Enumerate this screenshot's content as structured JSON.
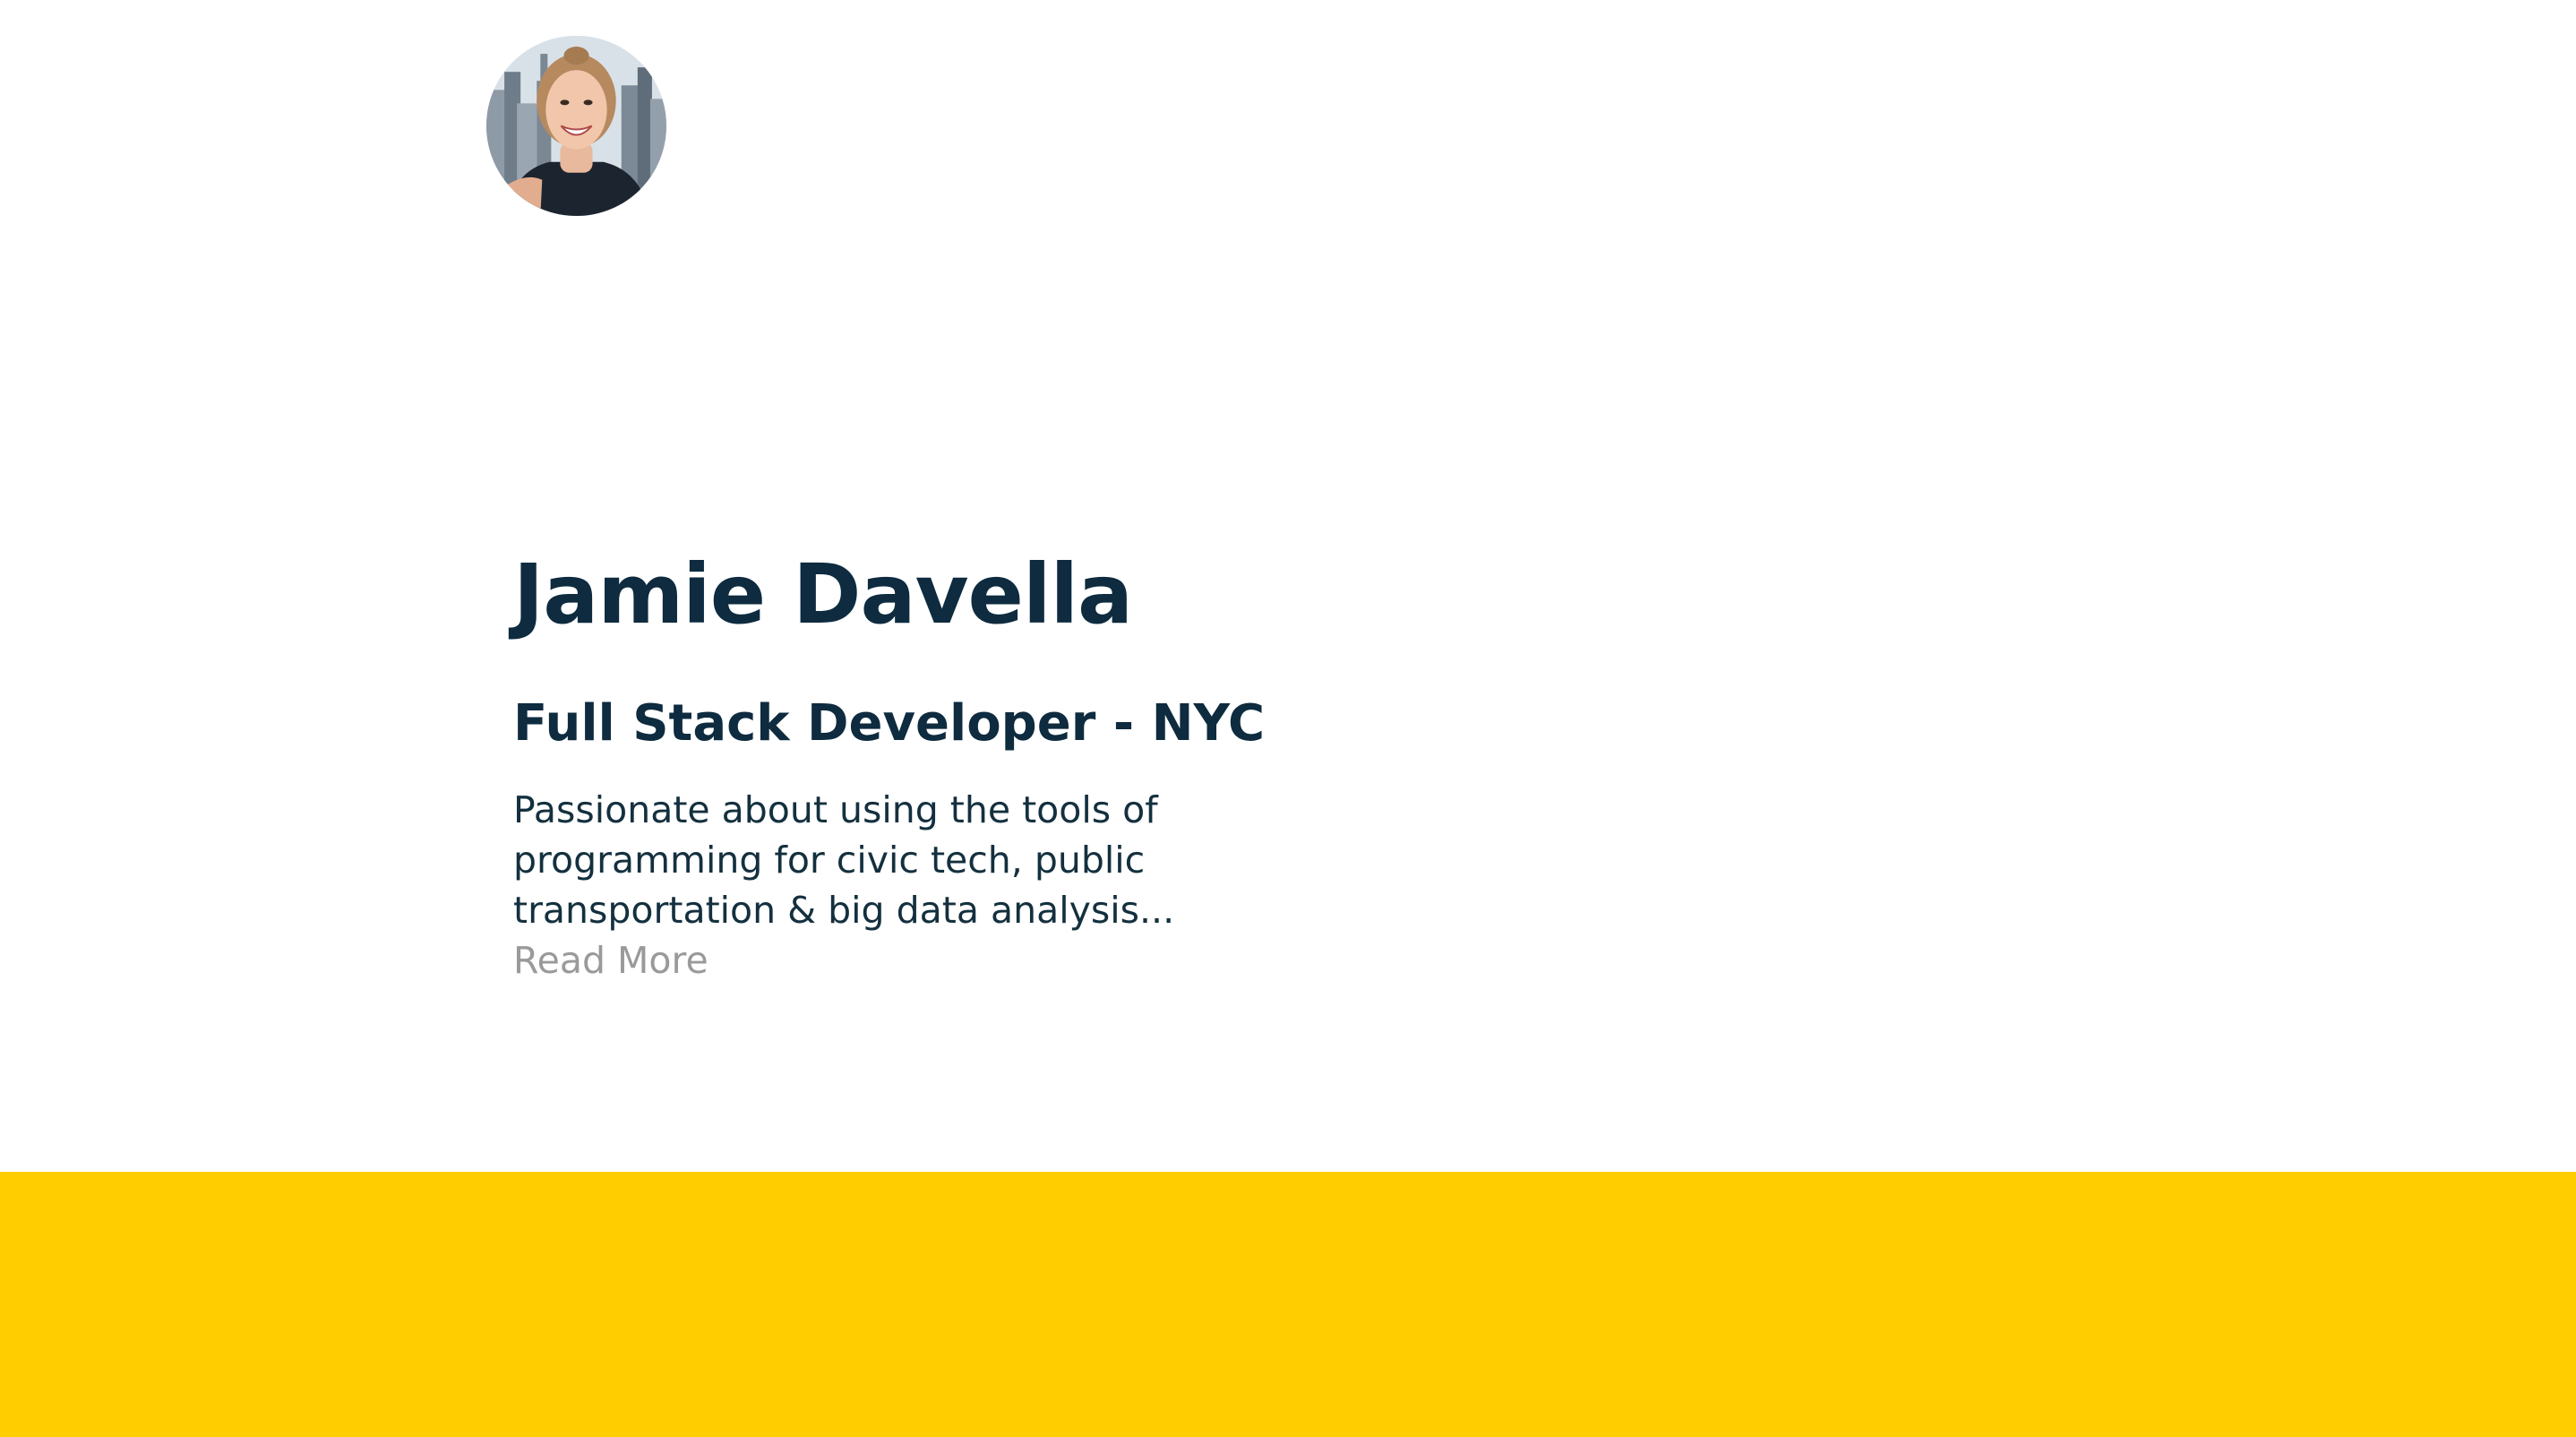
{
  "profile": {
    "avatar_alt": "Jamie Davella",
    "name": "Jamie Davella",
    "role": "Full Stack Developer - NYC",
    "bio": "Passionate about using the tools of programming for civic tech, public transportation & big data analysis...",
    "read_more_label": "Read More"
  },
  "colors": {
    "heading": "#0e2b3f",
    "body_text": "#14303f",
    "link_muted": "#9a9a9a",
    "accent_band": "#ffcd00",
    "background": "#ffffff"
  }
}
